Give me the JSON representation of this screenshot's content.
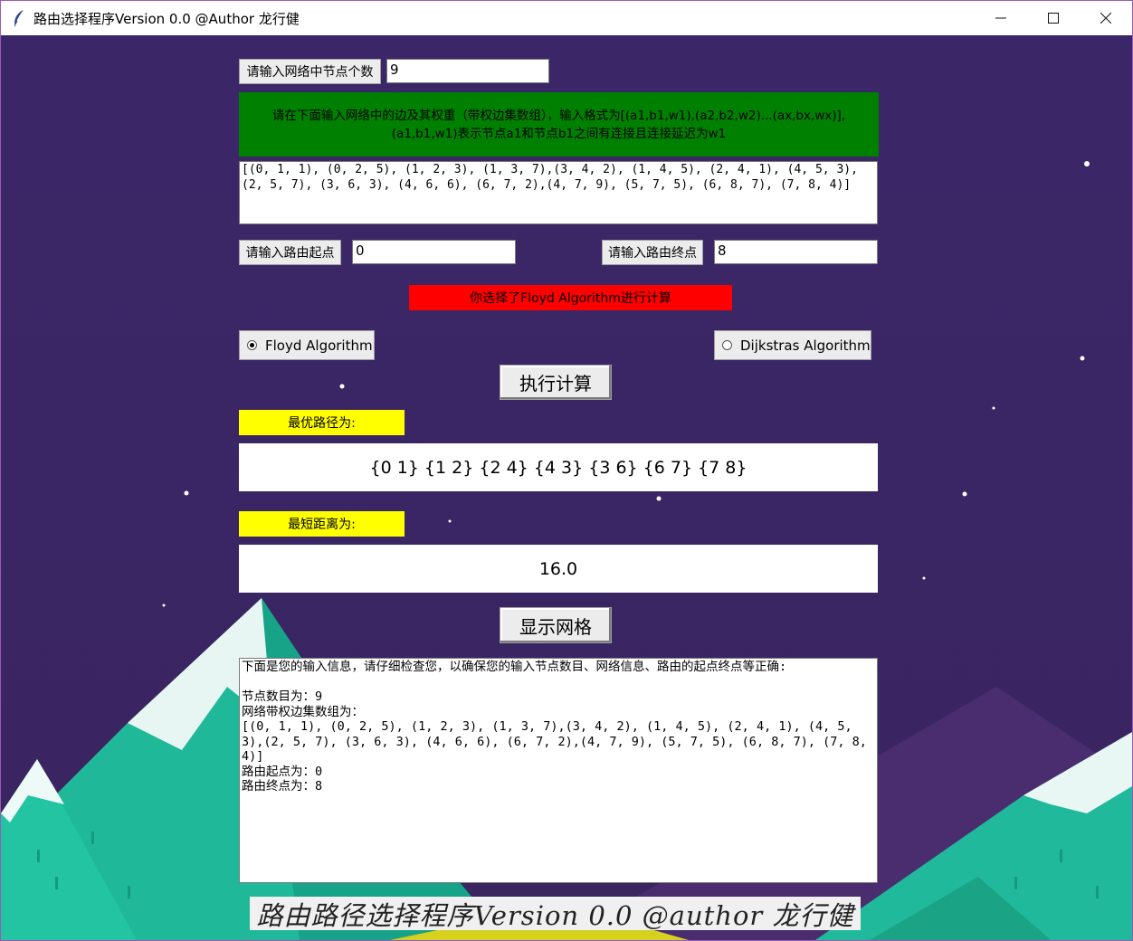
{
  "window": {
    "title": "路由选择程序Version 0.0 @Author 龙行健"
  },
  "icons": {
    "app": "feather-icon",
    "minimize": "minimize-icon",
    "maximize": "maximize-icon",
    "close": "close-icon"
  },
  "nodes": {
    "label": "请输入网络中节点个数",
    "value": "9"
  },
  "edges": {
    "banner": "请在下面输入网络中的边及其权重（带权边集数组），输入格式为[(a1,b1,w1),(a2,b2,w2)...(ax,bx,wx)],(a1,b1,w1)表示节点a1和节点b1之间有连接且连接延迟为w1",
    "value": "[(0, 1, 1), (0, 2, 5), (1, 2, 3), (1, 3, 7),(3, 4, 2), (1, 4, 5), (2, 4, 1), (4, 5, 3),(2, 5, 7), (3, 6, 3), (4, 6, 6), (6, 7, 2),(4, 7, 9), (5, 7, 5), (6, 8, 7), (7, 8, 4)]"
  },
  "route": {
    "start_label": "请输入路由起点",
    "start_value": "0",
    "end_label": "请输入路由终点",
    "end_value": "8"
  },
  "status": {
    "message": "你选择了Floyd Algorithm进行计算"
  },
  "algorithms": {
    "floyd": "Floyd Algorithm",
    "dijkstra": "Dijkstras Algorithm",
    "selected": "floyd"
  },
  "actions": {
    "compute": "执行计算",
    "show_network": "显示网格"
  },
  "results": {
    "path_label": "最优路径为:",
    "path_value": "{0 1} {1 2} {2 4} {4 3} {3 6} {6 7} {7 8}",
    "distance_label": "最短距离为:",
    "distance_value": "16.0"
  },
  "summary": {
    "text": "下面是您的输入信息，请仔细检查您，以确保您的输入节点数目、网络信息、路由的起点终点等正确:\n\n节点数目为：9\n网络带权边集数组为：\n[(0, 1, 1), (0, 2, 5), (1, 2, 3), (1, 3, 7),(3, 4, 2), (1, 4, 5), (2, 4, 1), (4, 5, 3),(2, 5, 7), (3, 6, 3), (4, 6, 6), (6, 7, 2),(4, 7, 9), (5, 7, 5), (6, 8, 7), (7, 8, 4)]\n路由起点为：0\n路由终点为：8"
  },
  "footer": {
    "text": "路由路径选择程序Version 0.0 @author 龙行健"
  },
  "colors": {
    "background": "#3a2566",
    "banner_green": "#008000",
    "banner_red": "#ff0000",
    "label_yellow": "#ffff00",
    "mountain_teal": "#1fb99a"
  }
}
